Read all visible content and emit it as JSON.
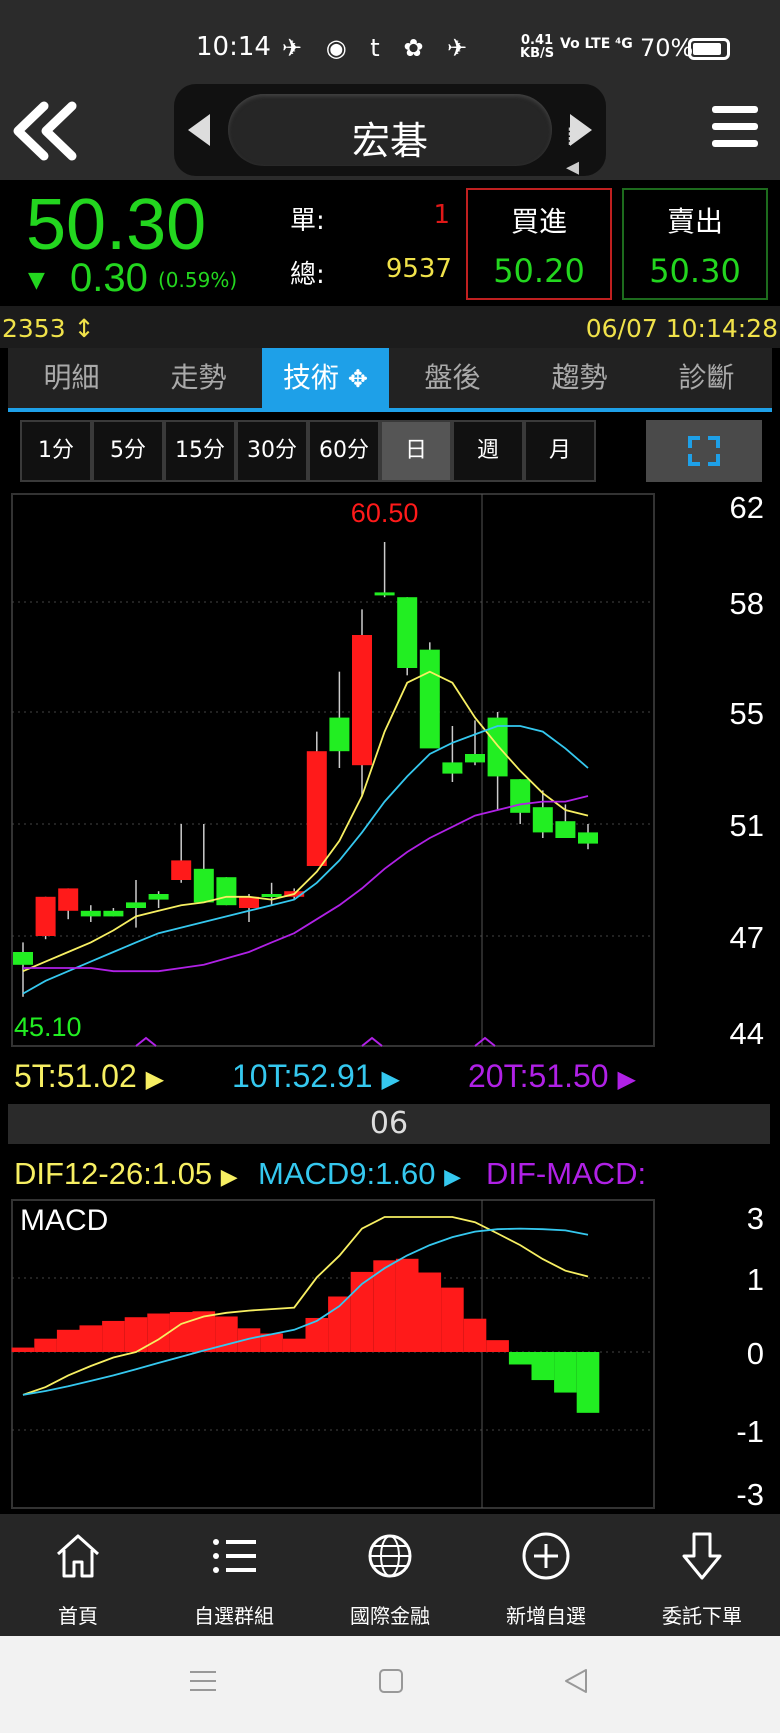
{
  "status_bar": {
    "time": "10:14",
    "net_speed": "0.41",
    "net_unit": "KB/S",
    "network": "Vo LTE ⁴G",
    "battery": "70%"
  },
  "header": {
    "stock_name": "宏碁"
  },
  "quote": {
    "price": "50.30",
    "change": "0.30",
    "change_pct": "(0.59%)",
    "single_label": "單:",
    "single_value": "1",
    "total_label": "總:",
    "total_value": "9537",
    "buy_label": "買進",
    "buy_price": "50.20",
    "sell_label": "賣出",
    "sell_price": "50.30"
  },
  "info": {
    "code": "2353",
    "datetime": "06/07 10:14:28"
  },
  "tabs": [
    "明細",
    "走勢",
    "技術",
    "盤後",
    "趨勢",
    "診斷"
  ],
  "periods": [
    "1分",
    "5分",
    "15分",
    "30分",
    "60分",
    "日",
    "週",
    "月"
  ],
  "colors": {
    "up": "#ff1a1a",
    "down": "#22ee22",
    "ma5": "#f7ef62",
    "ma10": "#35c8ef",
    "ma20": "#b021e6",
    "accent": "#1ea0e8"
  },
  "chart_data": [
    {
      "type": "candlestick",
      "period": "日",
      "y_ticks": [
        62,
        58,
        55,
        51,
        47,
        44
      ],
      "ylim": [
        44,
        62
      ],
      "max_label": "60.50",
      "min_label": "45.10",
      "x_tick": "06",
      "candles": [
        {
          "o": 46.5,
          "h": 46.8,
          "l": 45.1,
          "c": 46.1
        },
        {
          "o": 47.0,
          "h": 48.4,
          "l": 46.9,
          "c": 48.4
        },
        {
          "o": 47.9,
          "h": 48.7,
          "l": 47.6,
          "c": 48.7
        },
        {
          "o": 47.9,
          "h": 48.1,
          "l": 47.5,
          "c": 47.7
        },
        {
          "o": 47.9,
          "h": 48.0,
          "l": 47.7,
          "c": 47.7
        },
        {
          "o": 48.2,
          "h": 49.0,
          "l": 47.3,
          "c": 48.0
        },
        {
          "o": 48.5,
          "h": 48.6,
          "l": 48.0,
          "c": 48.3
        },
        {
          "o": 49.0,
          "h": 51.0,
          "l": 48.9,
          "c": 49.7
        },
        {
          "o": 49.4,
          "h": 51.0,
          "l": 48.2,
          "c": 48.2
        },
        {
          "o": 49.1,
          "h": 49.1,
          "l": 48.1,
          "c": 48.1
        },
        {
          "o": 48.0,
          "h": 48.5,
          "l": 47.5,
          "c": 48.4
        },
        {
          "o": 48.5,
          "h": 48.9,
          "l": 48.1,
          "c": 48.4
        },
        {
          "o": 48.4,
          "h": 48.7,
          "l": 48.3,
          "c": 48.6
        },
        {
          "o": 49.5,
          "h": 54.3,
          "l": 49.5,
          "c": 53.6
        },
        {
          "o": 54.8,
          "h": 56.1,
          "l": 53.0,
          "c": 53.6
        },
        {
          "o": 53.1,
          "h": 57.8,
          "l": 52.0,
          "c": 57.1
        },
        {
          "o": 58.4,
          "h": 60.5,
          "l": 58.2,
          "c": 58.3
        },
        {
          "o": 58.2,
          "h": 58.2,
          "l": 56.0,
          "c": 56.2
        },
        {
          "o": 56.7,
          "h": 56.9,
          "l": 53.8,
          "c": 53.7
        },
        {
          "o": 53.2,
          "h": 54.5,
          "l": 52.5,
          "c": 52.8
        },
        {
          "o": 53.5,
          "h": 54.7,
          "l": 53.1,
          "c": 53.2
        },
        {
          "o": 54.8,
          "h": 55.0,
          "l": 51.5,
          "c": 52.7
        },
        {
          "o": 52.6,
          "h": 52.6,
          "l": 51.0,
          "c": 51.4
        },
        {
          "o": 51.6,
          "h": 52.2,
          "l": 50.5,
          "c": 50.7
        },
        {
          "o": 51.1,
          "h": 51.7,
          "l": 50.7,
          "c": 50.5
        },
        {
          "o": 50.7,
          "h": 51.0,
          "l": 50.1,
          "c": 50.3
        }
      ],
      "series": [
        {
          "name": "5T",
          "values": [
            45.9,
            46.2,
            46.5,
            46.8,
            47.2,
            47.7,
            47.9,
            48.1,
            48.2,
            48.4,
            48.4,
            48.3,
            48.5,
            49.3,
            50.4,
            52.0,
            54.3,
            55.8,
            56.1,
            55.8,
            54.8,
            53.8,
            52.9,
            52.1,
            51.5,
            51.3
          ]
        },
        {
          "name": "10T",
          "values": [
            45.2,
            45.6,
            45.9,
            46.2,
            46.5,
            46.8,
            47.1,
            47.3,
            47.5,
            47.7,
            47.9,
            48.1,
            48.3,
            48.9,
            49.7,
            50.7,
            51.8,
            52.7,
            53.5,
            53.9,
            54.2,
            54.5,
            54.5,
            54.3,
            53.7,
            53.0
          ]
        },
        {
          "name": "20T",
          "values": [
            46.0,
            46.0,
            46.0,
            46.0,
            45.9,
            45.9,
            45.9,
            46.0,
            46.1,
            46.3,
            46.5,
            46.8,
            47.1,
            47.6,
            48.1,
            48.7,
            49.4,
            50.0,
            50.5,
            50.9,
            51.3,
            51.5,
            51.7,
            51.8,
            51.8,
            52.0
          ]
        }
      ],
      "legend": [
        "5T:51.02",
        "10T:52.91",
        "20T:51.50"
      ]
    },
    {
      "type": "bar",
      "name": "MACD",
      "y_ticks": [
        3,
        1,
        0,
        -1,
        -3
      ],
      "ylim": [
        -3,
        3
      ],
      "legend": [
        "DIF12-26:1.05",
        "MACD9:1.60",
        "DIF-MACD:"
      ],
      "histogram": [
        0.06,
        0.18,
        0.3,
        0.36,
        0.42,
        0.47,
        0.52,
        0.54,
        0.55,
        0.48,
        0.32,
        0.25,
        0.18,
        0.46,
        0.75,
        1.2,
        1.58,
        1.63,
        1.18,
        0.87,
        0.45,
        0.16,
        -0.16,
        -0.36,
        -0.52,
        -0.78
      ],
      "series": [
        {
          "name": "DIF12-26",
          "values": [
            -0.55,
            -0.45,
            -0.3,
            -0.18,
            -0.07,
            0.0,
            0.17,
            0.38,
            0.48,
            0.53,
            0.56,
            0.58,
            0.6,
            1.02,
            1.73,
            2.62,
            3.18,
            3.32,
            3.27,
            3.05,
            2.83,
            2.46,
            2.08,
            1.62,
            1.24,
            1.05
          ]
        },
        {
          "name": "MACD9",
          "values": [
            -0.55,
            -0.5,
            -0.44,
            -0.37,
            -0.3,
            -0.22,
            -0.14,
            -0.06,
            0.02,
            0.1,
            0.18,
            0.24,
            0.3,
            0.42,
            0.62,
            0.92,
            1.32,
            1.74,
            2.08,
            2.34,
            2.52,
            2.6,
            2.62,
            2.6,
            2.56,
            2.42
          ]
        }
      ]
    }
  ],
  "bottom_nav": [
    "首頁",
    "自選群組",
    "國際金融",
    "新增自選",
    "委託下單"
  ]
}
